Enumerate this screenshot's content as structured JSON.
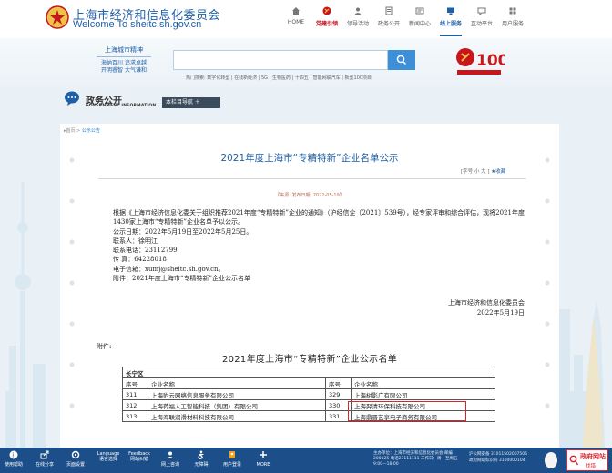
{
  "header": {
    "site_title": "上海市经济和信息化委员会",
    "site_url": "Welcome To sheitc.sh.gov.cn",
    "nav": [
      {
        "label": "HOME",
        "icon": "home-icon"
      },
      {
        "label": "党建引领",
        "icon": "party-icon"
      },
      {
        "label": "领导活动",
        "icon": "leader-icon"
      },
      {
        "label": "政务公开",
        "icon": "gov-icon"
      },
      {
        "label": "新闻中心",
        "icon": "news-icon"
      },
      {
        "label": "线上服务",
        "icon": "service-icon"
      },
      {
        "label": "互动平台",
        "icon": "interact-icon"
      },
      {
        "label": "用户服务",
        "icon": "user-icon"
      }
    ]
  },
  "banner": {
    "spirit_title": "上海城市精神",
    "spirit_lines": [
      "海纳百川 追求卓越",
      "开明睿智 大气谦和"
    ],
    "search_placeholder": "",
    "hot_words": "热门搜索: 数字化转型 | 在线新经济 | 5G | 生物医药 | 十四五 | 智能网联汽车 | 新型100项目"
  },
  "section": {
    "title": "政务公开",
    "subtitle": "GOVERNMENT INFORMATION",
    "guide_label": "本栏目导航 ＋"
  },
  "article": {
    "breadcrumb_home": "▸首页 >",
    "breadcrumb_current": "公示公告",
    "title": "2021年度上海市“专精特新”企业名单公示",
    "font_tools": "[字号  小  大 ]",
    "favorite": "★收藏",
    "source": "【来源:  发布日期: 2022-05-19】",
    "para1": "根据《上海市经济信息化委关于组织推荐2021年度“专精特新”企业的通知》（沪经信企〔2021〕539号），经专家评审和综合评估，现将2021年度1430家上海市“专精特新”企业名单予以公示。",
    "lines": [
      "公示日期：2022年5月19日至2022年5月25日。",
      "联系人：徐明江",
      "联系电话：23112799",
      "传  真：64228018",
      "电子信箱：xumj@sheitc.sh.gov.cn。",
      "附件：2021年度上海市“专精特新”企业公示名单"
    ],
    "sign_org": "上海市经济和信息化委员会",
    "sign_date": "2022年5月19日",
    "attach_label": "附件:",
    "table_title": "2021年度上海市“专精特新”企业公示名单",
    "region": "长宁区",
    "col_no": "序号",
    "col_name": "企业名称",
    "rows": [
      {
        "no1": "311",
        "name1": "上海豹云网络信息服务有限公司",
        "no2": "329",
        "name2": "上海树影广有限公司"
      },
      {
        "no1": "312",
        "name1": "上海荷福人工智能科技（集团）有限公司",
        "no2": "330",
        "name2": "上海羿清环保科技有限公司"
      },
      {
        "no1": "313",
        "name1": "上海海联润滑材料科技有限公司",
        "no2": "331",
        "name2": "上海鼎晋艺享电子商务有限公司"
      }
    ]
  },
  "toolbar": {
    "items": [
      {
        "label": "使用帮助",
        "icon": "help-icon"
      },
      {
        "label": "在线分享",
        "icon": "share-icon"
      },
      {
        "label": "页面设置",
        "icon": "settings-icon"
      },
      {
        "label": "Language 语言选择",
        "icon": "language-icon"
      },
      {
        "label": "Feedback 网站纠错",
        "icon": "feedback-icon"
      },
      {
        "label": "网上咨询",
        "icon": "consult-icon"
      },
      {
        "label": "无障碍",
        "icon": "accessibility-icon"
      },
      {
        "label": "用户登录",
        "icon": "login-icon"
      },
      {
        "label": "MORE",
        "icon": "more-icon"
      }
    ],
    "address": "主办单位：上海市经济和信息化委员会 邮编200125 电话23111111 工作日：周一至周五 9:00—18:00",
    "reg1": "沪公网安备 31011502007506",
    "reg2": "政府网站标识码 3100000104",
    "find_title": "政府网站",
    "find_sub": "找错"
  }
}
